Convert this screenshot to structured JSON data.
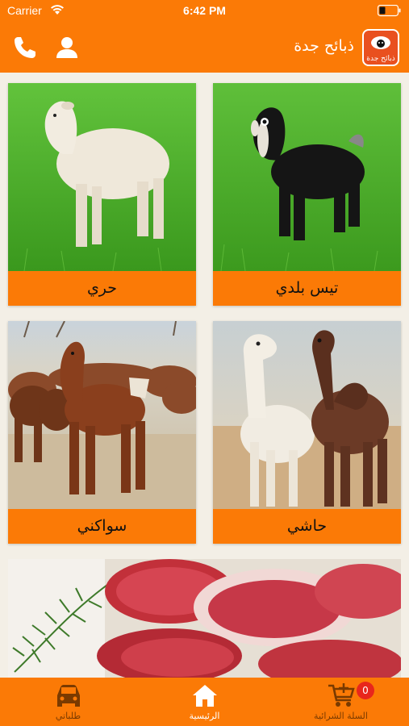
{
  "status_bar": {
    "carrier": "Carrier",
    "time": "6:42 PM",
    "wifi_icon": "wifi-icon",
    "battery_icon": "battery-icon"
  },
  "nav": {
    "title": "ذبائح جدة",
    "logo_text": "ذبائح جدة",
    "phone_icon": "phone-icon",
    "profile_icon": "user-icon"
  },
  "categories": [
    {
      "label": "تيس بلدي",
      "image": "black goat on grass"
    },
    {
      "label": "حري",
      "image": "white sheep on grass"
    },
    {
      "label": "حاشي",
      "image": "two camels"
    },
    {
      "label": "سواكني",
      "image": "herd of brown goats"
    }
  ],
  "tabs": [
    {
      "label": "السلة الشرائية",
      "icon": "cart-icon",
      "badge": "0",
      "active": false
    },
    {
      "label": "الرئيسية",
      "icon": "home-icon",
      "active": true
    },
    {
      "label": "طلباتي",
      "icon": "car-icon",
      "active": false
    }
  ],
  "colors": {
    "accent": "#fb7a06",
    "background": "#f3efe6",
    "badge": "#e8261c"
  }
}
